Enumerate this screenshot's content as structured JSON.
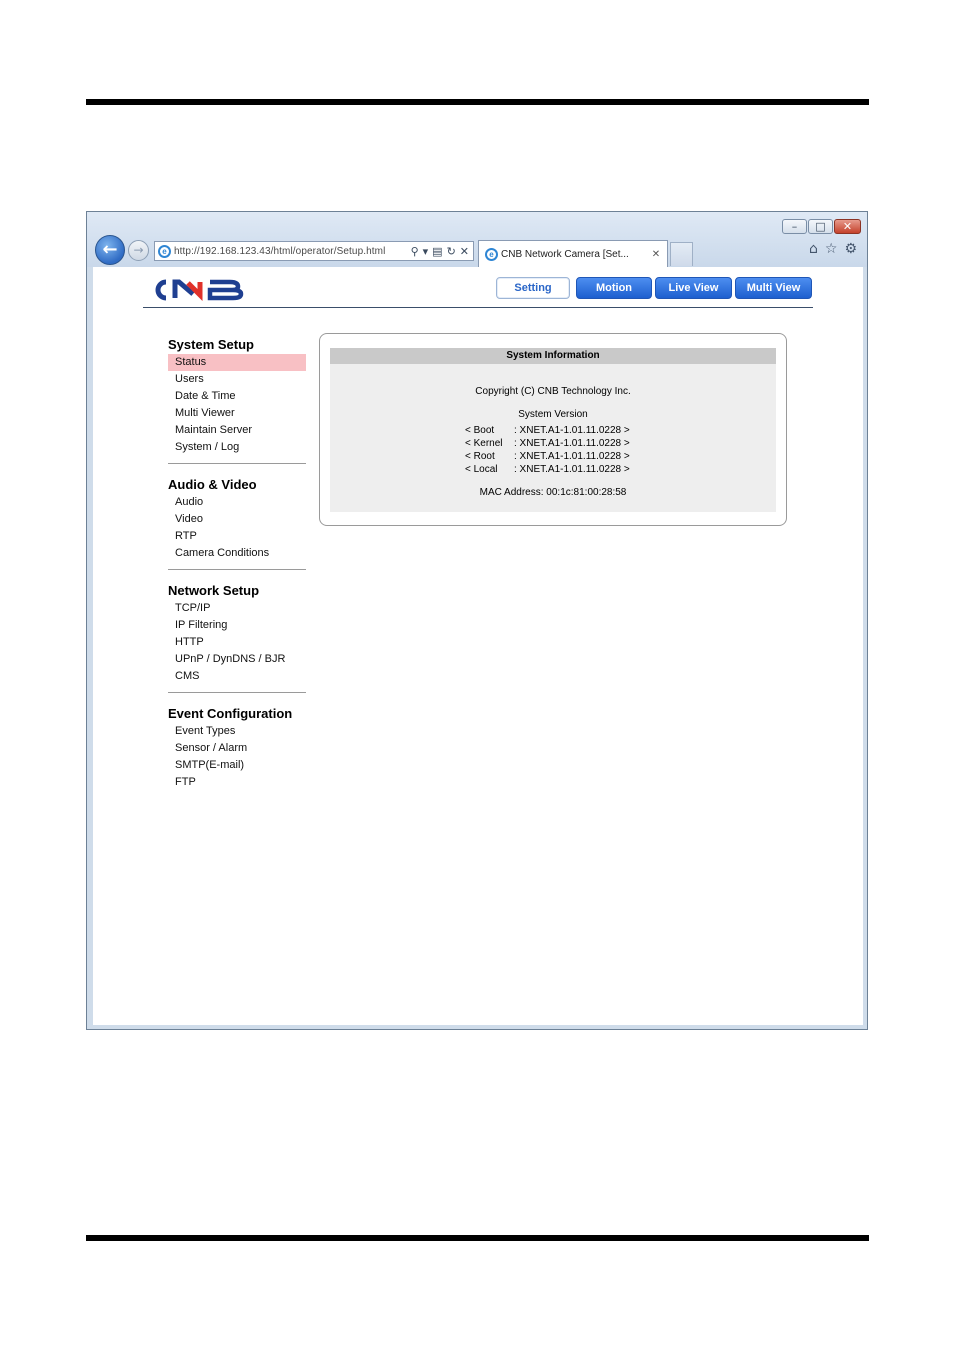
{
  "window": {
    "controls": {
      "minimize_glyph": "–",
      "maximize_glyph": "□",
      "close_glyph": "✕"
    }
  },
  "browser": {
    "back_glyph": "←",
    "forward_glyph": "→",
    "address_url": "http://192.168.123.43/html/operator/Setup.html",
    "tab_title": "CNB Network Camera [Set...",
    "tab_close_glyph": "✕",
    "toolbar_icons": [
      "home-icon",
      "star-icon",
      "gear-icon"
    ]
  },
  "header": {
    "logo_text": "CNB",
    "brand_color": "#1f3f91",
    "accent_color": "#e0312a",
    "nav": [
      "Setting",
      "Motion",
      "Live View",
      "Multi View"
    ],
    "active_nav": "Setting"
  },
  "sidebar": {
    "sections": [
      {
        "title": "System Setup",
        "items": [
          "Status",
          "Users",
          "Date & Time",
          "Multi Viewer",
          "Maintain Server",
          "System / Log"
        ]
      },
      {
        "title": "Audio & Video",
        "items": [
          "Audio",
          "Video",
          "RTP",
          "Camera Conditions"
        ]
      },
      {
        "title": "Network Setup",
        "items": [
          "TCP/IP",
          "IP Filtering",
          "HTTP",
          "UPnP / DynDNS / BJR",
          "CMS"
        ]
      },
      {
        "title": "Event Configuration",
        "items": [
          "Event Types",
          "Sensor / Alarm",
          "SMTP(E-mail)",
          "FTP"
        ]
      }
    ],
    "active_item": "Status"
  },
  "system_info": {
    "title": "System Information",
    "copyright": "Copyright (C) CNB Technology Inc.",
    "version_heading": "System Version",
    "versions": [
      {
        "label": "< Boot",
        "value": ": XNET.A1-1.01.11.0228 >"
      },
      {
        "label": "< Kernel",
        "value": ": XNET.A1-1.01.11.0228 >"
      },
      {
        "label": "< Root",
        "value": ": XNET.A1-1.01.11.0228 >"
      },
      {
        "label": "< Local",
        "value": ": XNET.A1-1.01.11.0228 >"
      }
    ],
    "mac": "MAC Address: 00:1c:81:00:28:58"
  }
}
